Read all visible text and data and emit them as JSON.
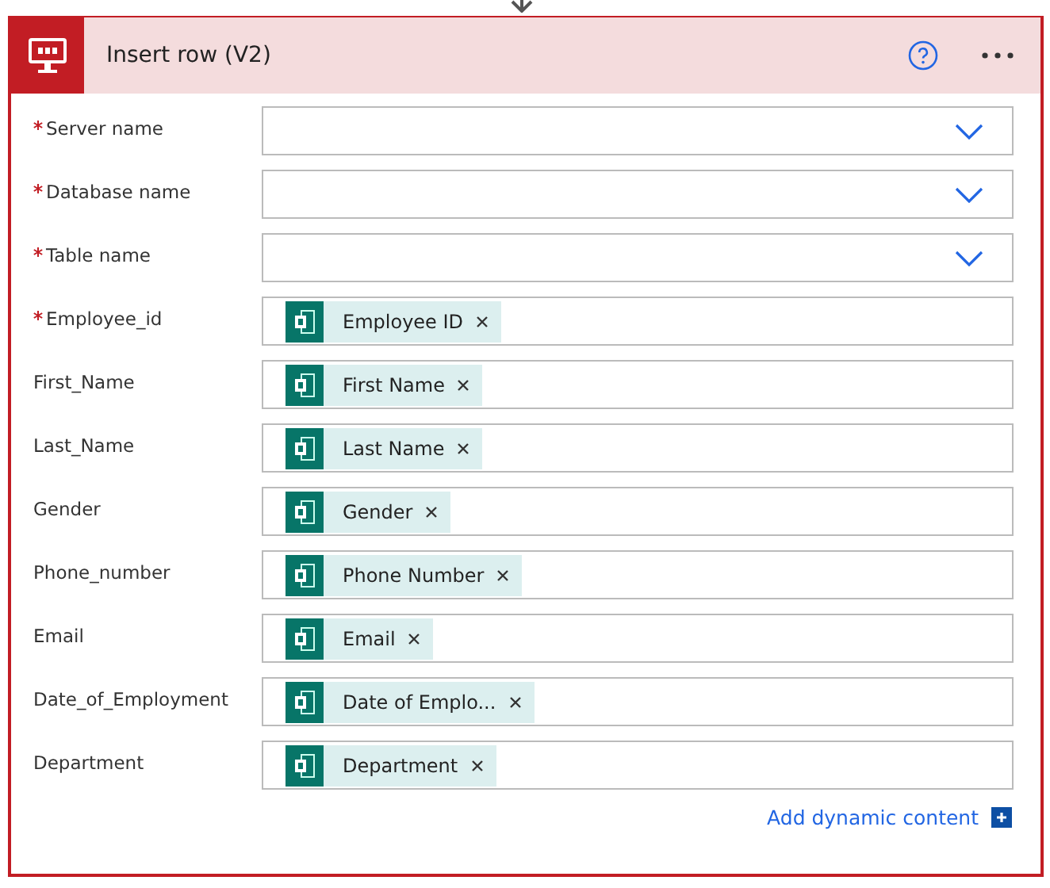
{
  "action": {
    "title": "Insert row (V2)"
  },
  "fields": [
    {
      "label": "Server name",
      "required": true,
      "kind": "dropdown"
    },
    {
      "label": "Database name",
      "required": true,
      "kind": "dropdown"
    },
    {
      "label": "Table name",
      "required": true,
      "kind": "dropdown"
    },
    {
      "label": "Employee_id",
      "required": true,
      "kind": "token",
      "token": "Employee ID"
    },
    {
      "label": "First_Name",
      "required": false,
      "kind": "token",
      "token": "First Name"
    },
    {
      "label": "Last_Name",
      "required": false,
      "kind": "token",
      "token": "Last Name"
    },
    {
      "label": "Gender",
      "required": false,
      "kind": "token",
      "token": "Gender"
    },
    {
      "label": "Phone_number",
      "required": false,
      "kind": "token",
      "token": "Phone Number"
    },
    {
      "label": "Email",
      "required": false,
      "kind": "token",
      "token": "Email"
    },
    {
      "label": "Date_of_Employment",
      "required": false,
      "kind": "token",
      "token": "Date of Emplo..."
    },
    {
      "label": "Department",
      "required": false,
      "kind": "token",
      "token": "Department"
    }
  ],
  "footer": {
    "link": "Add dynamic content"
  }
}
